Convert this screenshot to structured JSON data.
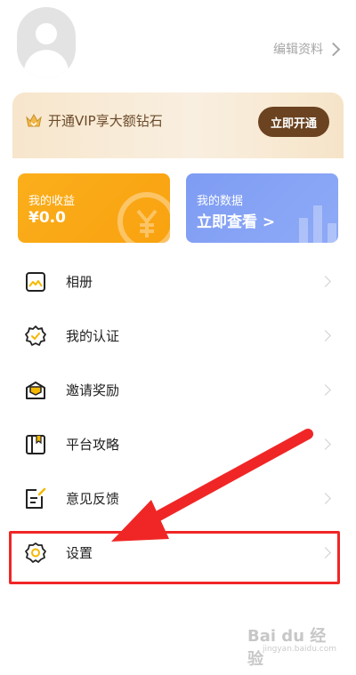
{
  "profile": {
    "edit_label": "编辑资料"
  },
  "vip": {
    "text": "开通VIP享大额钻石",
    "button_label": "立即开通"
  },
  "cards": {
    "income": {
      "title": "我的收益",
      "value": "¥0.0"
    },
    "data": {
      "title": "我的数据",
      "value": "立即查看 >"
    }
  },
  "menu": {
    "items": [
      {
        "label": "相册",
        "icon": "photo-album-icon"
      },
      {
        "label": "我的认证",
        "icon": "verified-badge-icon"
      },
      {
        "label": "邀请奖励",
        "icon": "invite-reward-icon"
      },
      {
        "label": "平台攻略",
        "icon": "guide-book-icon"
      },
      {
        "label": "意见反馈",
        "icon": "feedback-icon"
      },
      {
        "label": "设置",
        "icon": "gear-icon"
      }
    ]
  },
  "watermark": {
    "text": "Bai du 经验",
    "url": "jingyan.baidu.com"
  },
  "colors": {
    "vip_button": "#6b4320",
    "income_card": "#fbae1b",
    "data_card": "#7e9cf3",
    "annotation_red": "#f02626"
  }
}
